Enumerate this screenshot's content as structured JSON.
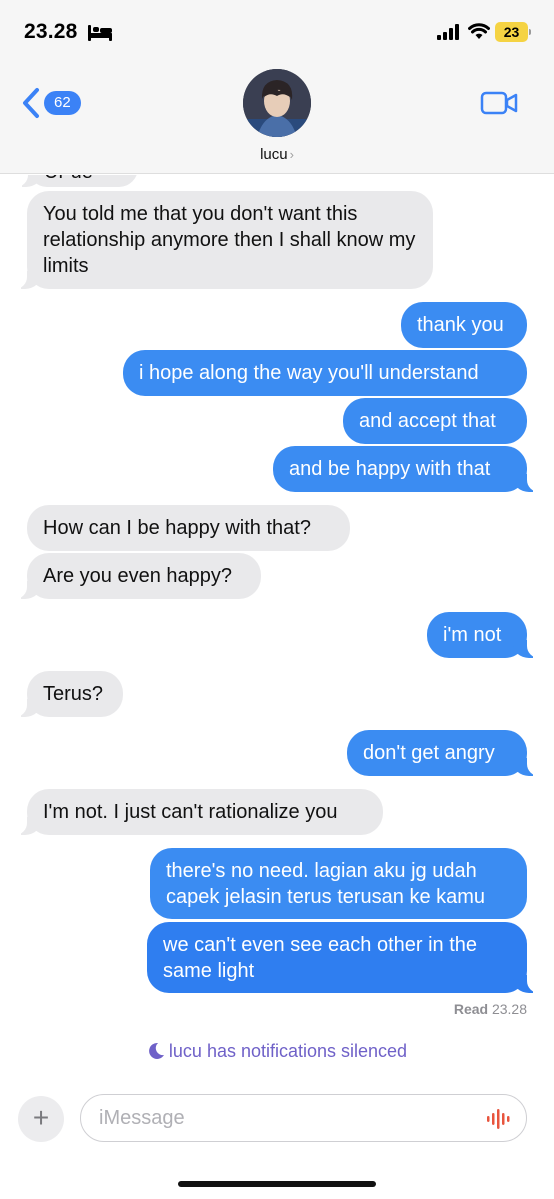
{
  "status_bar": {
    "time": "23.28",
    "battery": "23"
  },
  "header": {
    "back_count": "62",
    "contact_name": "lucu"
  },
  "messages": [
    {
      "side": "in",
      "text": "Ur ue"
    },
    {
      "side": "in",
      "text": "You told me that you don't want this relationship anymore then I shall know my limits"
    },
    {
      "side": "out",
      "text": "thank you"
    },
    {
      "side": "out",
      "text": "i hope along the way you'll understand"
    },
    {
      "side": "out",
      "text": "and accept that"
    },
    {
      "side": "out",
      "text": "and be happy with that"
    },
    {
      "side": "in",
      "text": "How can I be happy with that?"
    },
    {
      "side": "in",
      "text": "Are you even happy?"
    },
    {
      "side": "out",
      "text": "i'm not"
    },
    {
      "side": "in",
      "text": "Terus?"
    },
    {
      "side": "out",
      "text": "don't get angry"
    },
    {
      "side": "in",
      "text": "I'm not. I just can't rationalize you"
    },
    {
      "side": "out",
      "text": "there's no need. lagian aku jg udah capek jelasin terus terusan ke kamu"
    },
    {
      "side": "out",
      "text": "we can't even see each other in the same light"
    }
  ],
  "read_receipt": {
    "label": "Read",
    "time": "23.28"
  },
  "notice": "lucu has notifications silenced",
  "composer": {
    "placeholder": "iMessage"
  },
  "colors": {
    "outgoing": "#3b8cf2",
    "incoming": "#e9e9eb",
    "accent": "#3b82f6",
    "focus_purple": "#6f61c8"
  },
  "icons": [
    "bed-icon",
    "signal-icon",
    "wifi-icon",
    "back-chevron-icon",
    "video-call-icon",
    "moon-icon",
    "plus-icon",
    "audio-waveform-icon"
  ]
}
